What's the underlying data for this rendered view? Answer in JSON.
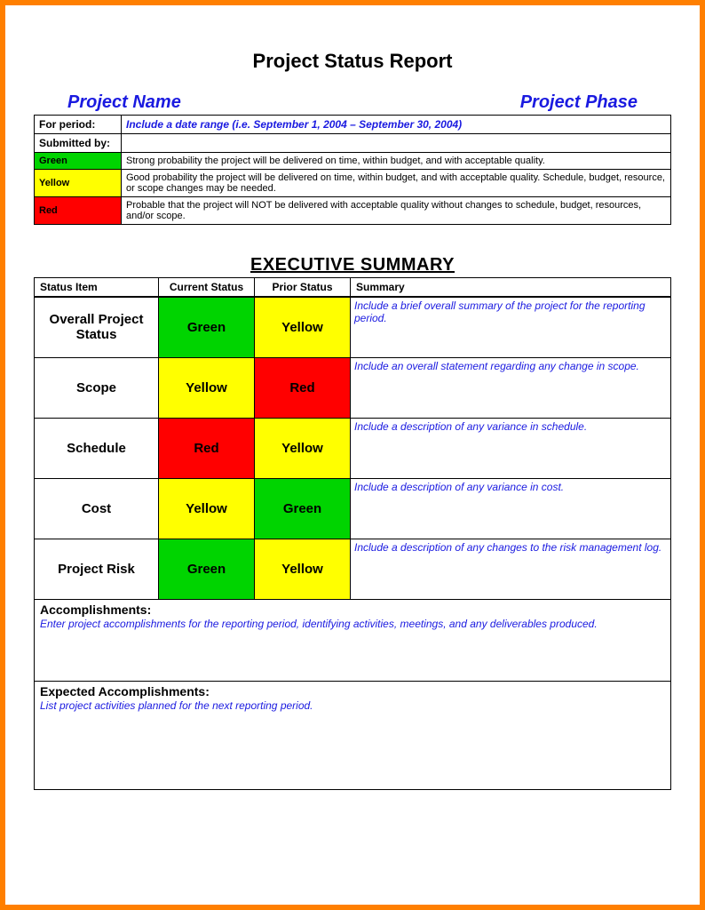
{
  "title": "Project Status Report",
  "header": {
    "left": "Project Name",
    "right": "Project Phase"
  },
  "info": {
    "for_period_label": "For period:",
    "for_period_value": "Include a date range (i.e. September 1, 2004 – September 30, 2004)",
    "submitted_by_label": "Submitted by:",
    "legend": [
      {
        "swatch": "Green",
        "class": "bg-green",
        "desc": "Strong probability the project will be delivered on time, within budget, and with acceptable quality."
      },
      {
        "swatch": "Yellow",
        "class": "bg-yellow",
        "desc": "Good probability the project will be delivered on time, within budget, and with acceptable quality. Schedule, budget, resource, or scope changes may be needed."
      },
      {
        "swatch": "Red",
        "class": "bg-red",
        "desc": "Probable that the project will NOT be delivered with acceptable quality without changes to schedule, budget, resources, and/or scope."
      }
    ]
  },
  "exec_heading": "EXECUTIVE SUMMARY",
  "columns": {
    "c0": "Status Item",
    "c1": "Current Status",
    "c2": "Prior Status",
    "c3": "Summary"
  },
  "rows": [
    {
      "item": "Overall Project Status",
      "current": "Green",
      "current_class": "bg-green",
      "prior": "Yellow",
      "prior_class": "bg-yellow",
      "summary": "Include a brief overall summary of the project for the reporting period."
    },
    {
      "item": "Scope",
      "current": "Yellow",
      "current_class": "bg-yellow",
      "prior": "Red",
      "prior_class": "bg-red",
      "summary": "Include an overall statement regarding any change in scope."
    },
    {
      "item": "Schedule",
      "current": "Red",
      "current_class": "bg-red",
      "prior": "Yellow",
      "prior_class": "bg-yellow",
      "summary": "Include a description of any variance in schedule."
    },
    {
      "item": "Cost",
      "current": "Yellow",
      "current_class": "bg-yellow",
      "prior": "Green",
      "prior_class": "bg-green",
      "summary": "Include a description of any variance in cost."
    },
    {
      "item": "Project Risk",
      "current": "Green",
      "current_class": "bg-green",
      "prior": "Yellow",
      "prior_class": "bg-yellow",
      "summary": "Include a description of any changes to the risk management log."
    }
  ],
  "accomplishments": {
    "label": "Accomplishments:",
    "hint": "Enter project accomplishments for the reporting period, identifying activities, meetings, and any deliverables produced."
  },
  "expected": {
    "label": "Expected Accomplishments:",
    "hint": "List project activities planned for the next reporting period."
  }
}
